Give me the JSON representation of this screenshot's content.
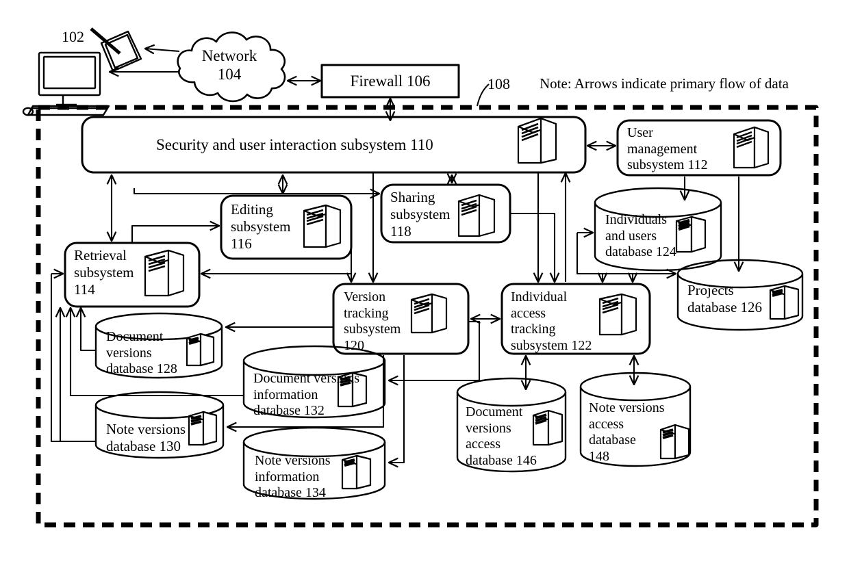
{
  "figure": {
    "kind": "patent-system-architecture-diagram",
    "note": "Note: Arrows indicate primary flow of data",
    "boundary_ref": "108",
    "client_ref": "102"
  },
  "external": {
    "client_device_ref": "102",
    "network": {
      "line1": "Network",
      "line2": "104"
    },
    "firewall": {
      "label": "Firewall  106"
    }
  },
  "subsystems": [
    {
      "id": "110",
      "label": "Security and user interaction subsystem  110",
      "lines": [
        "Security and user interaction subsystem  110"
      ]
    },
    {
      "id": "112",
      "label": "User management subsystem 112",
      "lines": [
        "User",
        "management",
        "subsystem 112"
      ]
    },
    {
      "id": "114",
      "label": "Retrieval subsystem 114",
      "lines": [
        "Retrieval",
        "subsystem",
        "114"
      ]
    },
    {
      "id": "116",
      "label": "Editing subsystem 116",
      "lines": [
        "Editing",
        "subsystem",
        "116"
      ]
    },
    {
      "id": "118",
      "label": "Sharing subsystem 118",
      "lines": [
        "Sharing",
        "subsystem",
        "118"
      ]
    },
    {
      "id": "120",
      "label": "Version tracking subsystem 120",
      "lines": [
        "Version",
        "tracking",
        "subsystem",
        "120"
      ]
    },
    {
      "id": "122",
      "label": "Individual access tracking subsystem 122",
      "lines": [
        "Individual",
        "access",
        "tracking",
        "subsystem 122"
      ]
    }
  ],
  "databases": [
    {
      "id": "124",
      "label": "Individuals and users database  124",
      "lines": [
        "Individuals",
        "and users",
        "database  124"
      ]
    },
    {
      "id": "126",
      "label": "Projects database 126",
      "lines": [
        "Projects",
        "database 126"
      ]
    },
    {
      "id": "128",
      "label": "Document versions database 128",
      "lines": [
        "Document",
        "versions",
        "database 128"
      ]
    },
    {
      "id": "130",
      "label": "Note versions database 130",
      "lines": [
        "Note versions",
        "database 130"
      ]
    },
    {
      "id": "132",
      "label": "Document versions information database 132",
      "lines": [
        "Document versions",
        "information",
        "database 132"
      ]
    },
    {
      "id": "134",
      "label": "Note versions information database 134",
      "lines": [
        "Note versions",
        "information",
        "database 134"
      ]
    },
    {
      "id": "146",
      "label": "Document versions access database 146",
      "lines": [
        "Document",
        "versions",
        "access",
        "database 146"
      ]
    },
    {
      "id": "148",
      "label": "Note versions access database 148",
      "lines": [
        "Note versions",
        "access",
        "database",
        "148"
      ]
    }
  ],
  "colors": {
    "ink": "#000000",
    "paper": "#ffffff"
  }
}
